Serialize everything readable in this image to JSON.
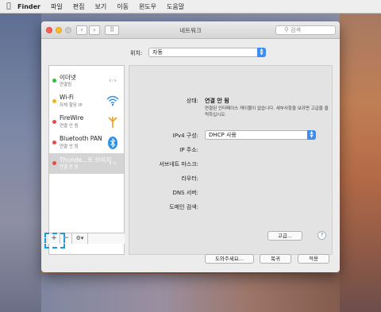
{
  "menubar": {
    "app": "Finder",
    "items": [
      "파일",
      "편집",
      "보기",
      "이동",
      "윈도우",
      "도움말"
    ]
  },
  "window": {
    "title": "네트워크",
    "search_placeholder": "검색",
    "back": "‹",
    "forward": "›",
    "grid": "⠿"
  },
  "location": {
    "label": "위치:",
    "value": "자동"
  },
  "services": [
    {
      "name": "이더넷",
      "status": "연결됨",
      "dot_color": "#2fbf3a",
      "icon": "ethernet-icon",
      "glyph": "‹·›"
    },
    {
      "name": "Wi-Fi",
      "status": "자체 할당 IP",
      "dot_color": "#f2b21f",
      "icon": "wifi-icon",
      "glyph": "◠"
    },
    {
      "name": "FireWire",
      "status": "연결 안 됨",
      "dot_color": "#e64a4a",
      "icon": "firewire-icon",
      "glyph": "Y"
    },
    {
      "name": "Bluetooth PAN",
      "status": "연결 안 됨",
      "dot_color": "#e64a4a",
      "icon": "bluetooth-icon",
      "glyph": "ᛒ"
    },
    {
      "name": "Thunde...트 브리지",
      "status": "연결 안 됨",
      "dot_color": "#e64a4a",
      "icon": "thunderbolt-bridge-icon",
      "glyph": "‹·›",
      "selected": true
    }
  ],
  "sidebar_toolbar": {
    "add": "+",
    "remove": "−",
    "gear": "⚙▾"
  },
  "detail": {
    "status_label": "상태:",
    "status_value": "연결 안 됨",
    "status_desc": "연결된 인터페이스 케이블이 없습니다. 세부사항을 보려면 고급을 클릭하십시오.",
    "ipv4_label": "IPv4 구성:",
    "ipv4_value": "DHCP 사용",
    "ip_label": "IP 주소:",
    "subnet_label": "서브네트 마스크:",
    "router_label": "라우터:",
    "dns_label": "DNS 서버:",
    "domain_label": "도메인 검색:"
  },
  "buttons": {
    "advanced": "고급...",
    "help": "?",
    "assist": "도와주세요...",
    "revert": "복귀",
    "apply": "적용"
  }
}
